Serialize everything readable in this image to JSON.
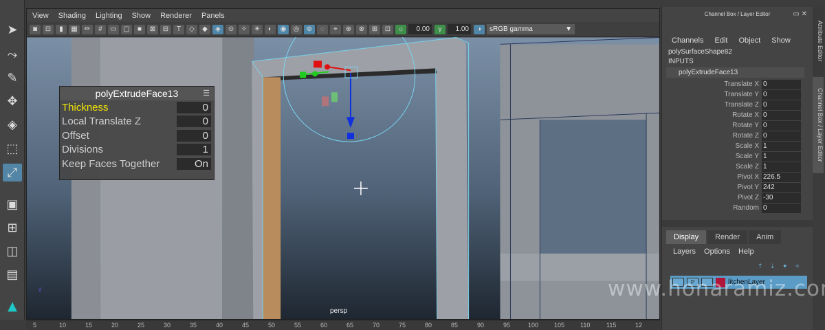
{
  "viewport_menu": [
    "View",
    "Shading",
    "Lighting",
    "Show",
    "Renderer",
    "Panels"
  ],
  "toolbar": {
    "exposure": "0.00",
    "gamma": "1.00",
    "color_space": "sRGB gamma"
  },
  "hud": {
    "title": "polyExtrudeFace13",
    "rows": [
      {
        "label": "Thickness",
        "value": "0"
      },
      {
        "label": "Local Translate Z",
        "value": "0"
      },
      {
        "label": "Offset",
        "value": "0"
      },
      {
        "label": "Divisions",
        "value": "1"
      },
      {
        "label": "Keep Faces Together",
        "value": "On"
      }
    ]
  },
  "camera_label": "persp",
  "axis_label": "Y",
  "timeline_ticks": [
    "5",
    "10",
    "15",
    "20",
    "25",
    "30",
    "35",
    "40",
    "45",
    "50",
    "55",
    "60",
    "65",
    "70",
    "75",
    "80",
    "85",
    "90",
    "95",
    "100",
    "105",
    "110",
    "115",
    "12"
  ],
  "channel_box": {
    "title": "Channel Box / Layer Editor",
    "menu": [
      "Channels",
      "Edit",
      "Object",
      "Show"
    ],
    "shape": "polySurfaceShape82",
    "inputs_label": "INPUTS",
    "node": "polyExtrudeFace13",
    "attrs": [
      {
        "name": "Translate X",
        "value": "0"
      },
      {
        "name": "Translate Y",
        "value": "0"
      },
      {
        "name": "Translate Z",
        "value": "0"
      },
      {
        "name": "Rotate X",
        "value": "0"
      },
      {
        "name": "Rotate Y",
        "value": "0"
      },
      {
        "name": "Rotate Z",
        "value": "0"
      },
      {
        "name": "Scale X",
        "value": "1"
      },
      {
        "name": "Scale Y",
        "value": "1"
      },
      {
        "name": "Scale Z",
        "value": "1"
      },
      {
        "name": "Pivot X",
        "value": "226.5"
      },
      {
        "name": "Pivot Y",
        "value": "242"
      },
      {
        "name": "Pivot Z",
        "value": "-30"
      },
      {
        "name": "Random",
        "value": "0"
      }
    ]
  },
  "layer_editor": {
    "tabs": [
      "Display",
      "Render",
      "Anim"
    ],
    "menu": [
      "Layers",
      "Options",
      "Help"
    ],
    "layer": {
      "p_label": "P",
      "name": "litchenLayer",
      "color": "#b0153a"
    }
  },
  "side_tabs": [
    "Attribute Editor",
    "Channel Box / Layer Editor"
  ],
  "watermark": "www.honaramiz.com",
  "colors": {
    "selection": "#5b9cc6",
    "highlight": "#f3e600",
    "manip_x": "#e01010",
    "manip_y": "#1fcc1f",
    "manip_z": "#1030e0"
  }
}
